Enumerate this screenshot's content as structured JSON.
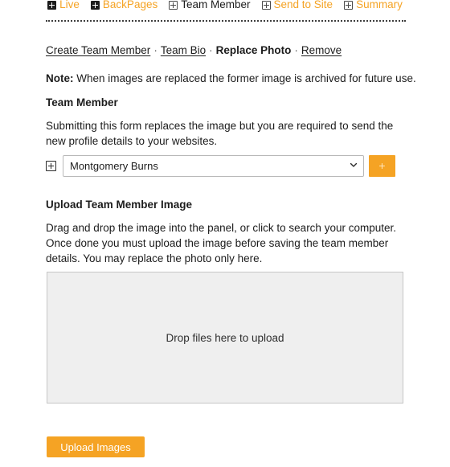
{
  "topnav": {
    "items": [
      {
        "label": "Live",
        "icon": "plus-square-icon",
        "style": "solid",
        "state": "link"
      },
      {
        "label": "BackPages",
        "icon": "plus-square-icon",
        "style": "solid",
        "state": "link"
      },
      {
        "label": "Team Member",
        "icon": "plus-square-icon",
        "style": "outline",
        "state": "active"
      },
      {
        "label": "Send to Site",
        "icon": "plus-square-icon",
        "style": "outline",
        "state": "link"
      },
      {
        "label": "Summary",
        "icon": "plus-square-icon",
        "style": "outline",
        "state": "link"
      }
    ]
  },
  "crumbs": {
    "create": "Create Team Member",
    "bio": "Team Bio",
    "current": "Replace Photo",
    "remove": "Remove",
    "separator": "·"
  },
  "note": {
    "label": "Note:",
    "text": " When images are replaced the former image is archived for future use."
  },
  "team_member": {
    "heading": "Team Member",
    "description": "Submitting this form replaces the image but you are required to send the new profile details to your websites.",
    "expand_icon": "plus-square-icon",
    "selected": "Montgomery Burns",
    "options": [
      "Montgomery Burns"
    ],
    "add_button_label": "+"
  },
  "upload": {
    "heading": "Upload Team Member Image",
    "description": "Drag and drop the image into the panel, or click to search your computer. Once done you must upload the image before saving the team member details. You may replace the photo only here.",
    "dropzone_text": "Drop files here to upload",
    "button_label": "Upload Images"
  },
  "colors": {
    "accent_orange": "#f5a324",
    "text": "#1c1c1c",
    "dropzone_bg": "#efefef",
    "dropzone_border": "#c6c6c6"
  }
}
